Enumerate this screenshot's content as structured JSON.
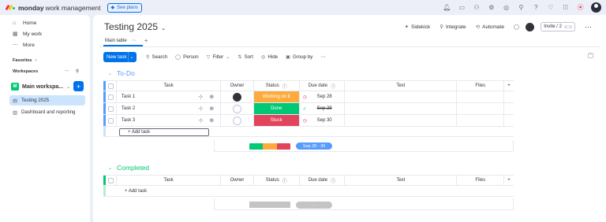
{
  "topbar": {
    "brand": "monday",
    "brand_sub": "work management",
    "see_plans": "See plans"
  },
  "sidebar": {
    "items": [
      {
        "label": "Home",
        "icon": "home-icon"
      },
      {
        "label": "My work",
        "icon": "calendar-icon"
      },
      {
        "label": "More",
        "icon": "more-icon"
      }
    ],
    "favorites": "Favorites",
    "workspaces": "Workspaces",
    "workspace_name": "Main workspa...",
    "workspace_badge": "M",
    "boards": [
      {
        "label": "Testing 2025",
        "active": true
      },
      {
        "label": "Dashboard and reporting",
        "active": false
      }
    ]
  },
  "board": {
    "title": "Testing 2025",
    "view_tab": "Main table",
    "actions": {
      "sidekick": "Sidekick",
      "integrate": "Integrate",
      "automate": "Automate",
      "invite": "Invite / 2"
    }
  },
  "toolbar": {
    "new_task": "New task",
    "search": "Search",
    "person": "Person",
    "filter": "Filter",
    "sort": "Sort",
    "hide": "Hide",
    "group_by": "Group by"
  },
  "columns": {
    "task": "Task",
    "owner": "Owner",
    "status": "Status",
    "due": "Due date",
    "text": "Text",
    "files": "Files"
  },
  "groups": [
    {
      "title": "To-Do",
      "color": "#579bfc",
      "rows": [
        {
          "task": "Task 1",
          "owner": "filled",
          "status": "Working on it",
          "status_color": "#fdab3d",
          "due": "Sep 28",
          "due_icon": "!",
          "strike": false
        },
        {
          "task": "Task 2",
          "owner": "empty",
          "status": "Done",
          "status_color": "#00c875",
          "due": "Sep 29",
          "due_icon": "✓",
          "strike": true
        },
        {
          "task": "Task 3",
          "owner": "empty",
          "status": "Stuck",
          "status_color": "#e2445c",
          "due": "Sep 30",
          "due_icon": "!",
          "strike": false
        }
      ],
      "add_task": "+ Add task",
      "summary_date": "Sep 28 - 30"
    },
    {
      "title": "Completed",
      "color": "#00c875",
      "rows": [],
      "add_task": "+ Add task",
      "summary_date": "-"
    }
  ]
}
